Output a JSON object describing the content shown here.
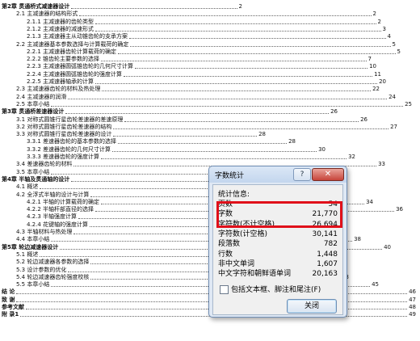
{
  "toc": [
    {
      "text": "第2章  贯通桥式减速器设计",
      "page": "2",
      "level": 0
    },
    {
      "text": "2.1  主减速器的结构形式",
      "page": "2",
      "level": 1
    },
    {
      "text": "2.1.1  主减速器的齿轮类型",
      "page": "2",
      "level": 2
    },
    {
      "text": "2.1.2  主减速器的减速形式",
      "page": "3",
      "level": 2
    },
    {
      "text": "2.1.3  主减速器主从动锥齿轮的支承方案",
      "page": "4",
      "level": 2
    },
    {
      "text": "2.2  主减速器基本参数选择与计算载荷的确定",
      "page": "5",
      "level": 1
    },
    {
      "text": "2.2.1  主减速器齿轮计算载荷的确定",
      "page": "5",
      "level": 2
    },
    {
      "text": "2.2.2  锥齿轮主要参数的选择",
      "page": "7",
      "level": 2
    },
    {
      "text": "2.2.3  主减速器圆弧锥齿轮的几何尺寸计算",
      "page": "10",
      "level": 2
    },
    {
      "text": "2.2.4  主减速器圆弧锥齿轮的强度计算",
      "page": "11",
      "level": 2
    },
    {
      "text": "2.2.5  主减速器轴承的计算",
      "page": "20",
      "level": 2
    },
    {
      "text": "2.3  主减速器齿轮的材料及热处理",
      "page": "22",
      "level": 1
    },
    {
      "text": "2.4  主减速器的润滑",
      "page": "24",
      "level": 1
    },
    {
      "text": "2.5  本章小结",
      "page": "25",
      "level": 1
    },
    {
      "text": "第3章  贯通桥差速器设计",
      "page": "26",
      "level": 0
    },
    {
      "text": "3.1  对称式圆锥行星齿轮差速器的差速原理",
      "page": "26",
      "level": 1
    },
    {
      "text": "3.2  对称式圆锥行星齿轮差速器的结构",
      "page": "27",
      "level": 1
    },
    {
      "text": "3.3  对称式圆锥行星齿轮差速器的设计",
      "page": "28",
      "level": 1
    },
    {
      "text": "3.3.1  差速器齿轮的基本参数的选择",
      "page": "28",
      "level": 2
    },
    {
      "text": "3.3.2  差速器齿轮的几何尺寸计算",
      "page": "30",
      "level": 2
    },
    {
      "text": "3.3.3  差速器齿轮的强度计算",
      "page": "32",
      "level": 2
    },
    {
      "text": "3.4  差速器齿轮的材料",
      "page": "33",
      "level": 1
    },
    {
      "text": "3.5  本章小结",
      "page": "33",
      "level": 1
    },
    {
      "text": "第4章  半轴及贯通轴的设计",
      "page": "34",
      "level": 0
    },
    {
      "text": "4.1  概述",
      "page": "34",
      "level": 1
    },
    {
      "text": "4.2  全浮式半轴的设计与计算",
      "page": "34",
      "level": 1
    },
    {
      "text": "4.2.1  半轴的计算载荷的确定",
      "page": "34",
      "level": 2
    },
    {
      "text": "4.2.2  半轴杆部直径的选择",
      "page": "36",
      "level": 2
    },
    {
      "text": "4.2.3  半轴强度计算",
      "page": "36",
      "level": 2
    },
    {
      "text": "4.2.4  花键轴的强度计算",
      "page": "37",
      "level": 2
    },
    {
      "text": "4.3  半轴材料与热处理",
      "page": "38",
      "level": 1
    },
    {
      "text": "4.4  本章小结",
      "page": "38",
      "level": 1
    },
    {
      "text": "第5章  轮边减速器设计",
      "page": "40",
      "level": 0
    },
    {
      "text": "5.1  概述",
      "page": "40",
      "level": 1
    },
    {
      "text": "5.2  轮边减速器各参数的选择",
      "page": "41",
      "level": 1
    },
    {
      "text": "5.3  设计参数的优化",
      "page": "42",
      "level": 1
    },
    {
      "text": "5.4  轮边减速器齿轮强度校核",
      "page": "43",
      "level": 1
    },
    {
      "text": "5.5  本章小结",
      "page": "45",
      "level": 1
    },
    {
      "text": "结  论",
      "page": "46",
      "level": 0
    },
    {
      "text": "致  谢",
      "page": "47",
      "level": 0
    },
    {
      "text": "参考文献",
      "page": "48",
      "level": 0
    },
    {
      "text": "附  录1",
      "page": "49",
      "level": 0
    }
  ],
  "dialog": {
    "title": "字数统计",
    "help_label": "?",
    "close_label": "✕",
    "stats_label": "统计信息:",
    "stats": [
      {
        "label": "页数",
        "value": "54"
      },
      {
        "label": "字数",
        "value": "21,770"
      },
      {
        "label": "字符数(不计空格)",
        "value": "26,694"
      },
      {
        "label": "字符数(计空格)",
        "value": "30,141"
      },
      {
        "label": "段落数",
        "value": "782"
      },
      {
        "label": "行数",
        "value": "1,448"
      },
      {
        "label": "非中文单词",
        "value": "1,607"
      },
      {
        "label": "中文字符和朝鲜语单词",
        "value": "20,163"
      }
    ],
    "checkbox_label": "包括文本框、脚注和尾注(F)",
    "checkbox_checked": false,
    "close_button_label": "关闭",
    "highlight_color": "#e0101a"
  }
}
